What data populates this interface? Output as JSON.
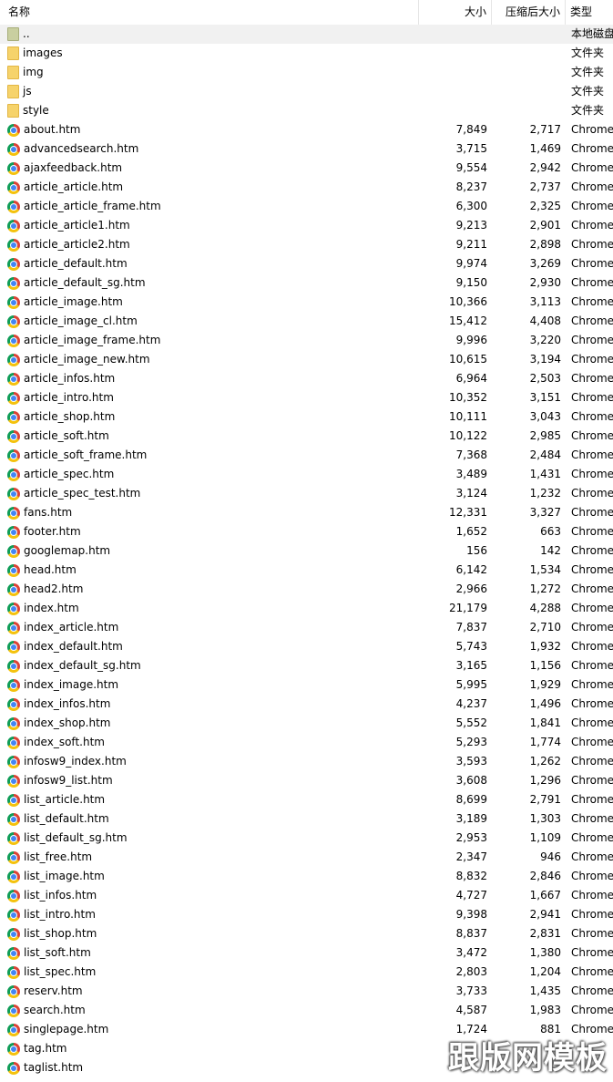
{
  "columns": {
    "name": "名称",
    "size": "大小",
    "compressed": "压缩后大小",
    "type": "类型"
  },
  "rows": [
    {
      "name": "..",
      "size": "",
      "csize": "",
      "type": "本地磁盘",
      "kind": "parent"
    },
    {
      "name": "images",
      "size": "",
      "csize": "",
      "type": "文件夹",
      "kind": "folder"
    },
    {
      "name": "img",
      "size": "",
      "csize": "",
      "type": "文件夹",
      "kind": "folder"
    },
    {
      "name": "js",
      "size": "",
      "csize": "",
      "type": "文件夹",
      "kind": "folder"
    },
    {
      "name": "style",
      "size": "",
      "csize": "",
      "type": "文件夹",
      "kind": "folder"
    },
    {
      "name": "about.htm",
      "size": "7,849",
      "csize": "2,717",
      "type": "Chrome",
      "kind": "file"
    },
    {
      "name": "advancedsearch.htm",
      "size": "3,715",
      "csize": "1,469",
      "type": "Chrome",
      "kind": "file"
    },
    {
      "name": "ajaxfeedback.htm",
      "size": "9,554",
      "csize": "2,942",
      "type": "Chrome",
      "kind": "file"
    },
    {
      "name": "article_article.htm",
      "size": "8,237",
      "csize": "2,737",
      "type": "Chrome",
      "kind": "file"
    },
    {
      "name": "article_article_frame.htm",
      "size": "6,300",
      "csize": "2,325",
      "type": "Chrome",
      "kind": "file"
    },
    {
      "name": "article_article1.htm",
      "size": "9,213",
      "csize": "2,901",
      "type": "Chrome",
      "kind": "file"
    },
    {
      "name": "article_article2.htm",
      "size": "9,211",
      "csize": "2,898",
      "type": "Chrome",
      "kind": "file"
    },
    {
      "name": "article_default.htm",
      "size": "9,974",
      "csize": "3,269",
      "type": "Chrome",
      "kind": "file"
    },
    {
      "name": "article_default_sg.htm",
      "size": "9,150",
      "csize": "2,930",
      "type": "Chrome",
      "kind": "file"
    },
    {
      "name": "article_image.htm",
      "size": "10,366",
      "csize": "3,113",
      "type": "Chrome",
      "kind": "file"
    },
    {
      "name": "article_image_cl.htm",
      "size": "15,412",
      "csize": "4,408",
      "type": "Chrome",
      "kind": "file"
    },
    {
      "name": "article_image_frame.htm",
      "size": "9,996",
      "csize": "3,220",
      "type": "Chrome",
      "kind": "file"
    },
    {
      "name": "article_image_new.htm",
      "size": "10,615",
      "csize": "3,194",
      "type": "Chrome",
      "kind": "file"
    },
    {
      "name": "article_infos.htm",
      "size": "6,964",
      "csize": "2,503",
      "type": "Chrome",
      "kind": "file"
    },
    {
      "name": "article_intro.htm",
      "size": "10,352",
      "csize": "3,151",
      "type": "Chrome",
      "kind": "file"
    },
    {
      "name": "article_shop.htm",
      "size": "10,111",
      "csize": "3,043",
      "type": "Chrome",
      "kind": "file"
    },
    {
      "name": "article_soft.htm",
      "size": "10,122",
      "csize": "2,985",
      "type": "Chrome",
      "kind": "file"
    },
    {
      "name": "article_soft_frame.htm",
      "size": "7,368",
      "csize": "2,484",
      "type": "Chrome",
      "kind": "file"
    },
    {
      "name": "article_spec.htm",
      "size": "3,489",
      "csize": "1,431",
      "type": "Chrome",
      "kind": "file"
    },
    {
      "name": "article_spec_test.htm",
      "size": "3,124",
      "csize": "1,232",
      "type": "Chrome",
      "kind": "file"
    },
    {
      "name": "fans.htm",
      "size": "12,331",
      "csize": "3,327",
      "type": "Chrome",
      "kind": "file"
    },
    {
      "name": "footer.htm",
      "size": "1,652",
      "csize": "663",
      "type": "Chrome",
      "kind": "file"
    },
    {
      "name": "googlemap.htm",
      "size": "156",
      "csize": "142",
      "type": "Chrome",
      "kind": "file"
    },
    {
      "name": "head.htm",
      "size": "6,142",
      "csize": "1,534",
      "type": "Chrome",
      "kind": "file"
    },
    {
      "name": "head2.htm",
      "size": "2,966",
      "csize": "1,272",
      "type": "Chrome",
      "kind": "file"
    },
    {
      "name": "index.htm",
      "size": "21,179",
      "csize": "4,288",
      "type": "Chrome",
      "kind": "file"
    },
    {
      "name": "index_article.htm",
      "size": "7,837",
      "csize": "2,710",
      "type": "Chrome",
      "kind": "file"
    },
    {
      "name": "index_default.htm",
      "size": "5,743",
      "csize": "1,932",
      "type": "Chrome",
      "kind": "file"
    },
    {
      "name": "index_default_sg.htm",
      "size": "3,165",
      "csize": "1,156",
      "type": "Chrome",
      "kind": "file"
    },
    {
      "name": "index_image.htm",
      "size": "5,995",
      "csize": "1,929",
      "type": "Chrome",
      "kind": "file"
    },
    {
      "name": "index_infos.htm",
      "size": "4,237",
      "csize": "1,496",
      "type": "Chrome",
      "kind": "file"
    },
    {
      "name": "index_shop.htm",
      "size": "5,552",
      "csize": "1,841",
      "type": "Chrome",
      "kind": "file"
    },
    {
      "name": "index_soft.htm",
      "size": "5,293",
      "csize": "1,774",
      "type": "Chrome",
      "kind": "file"
    },
    {
      "name": "infosw9_index.htm",
      "size": "3,593",
      "csize": "1,262",
      "type": "Chrome",
      "kind": "file"
    },
    {
      "name": "infosw9_list.htm",
      "size": "3,608",
      "csize": "1,296",
      "type": "Chrome",
      "kind": "file"
    },
    {
      "name": "list_article.htm",
      "size": "8,699",
      "csize": "2,791",
      "type": "Chrome",
      "kind": "file"
    },
    {
      "name": "list_default.htm",
      "size": "3,189",
      "csize": "1,303",
      "type": "Chrome",
      "kind": "file"
    },
    {
      "name": "list_default_sg.htm",
      "size": "2,953",
      "csize": "1,109",
      "type": "Chrome",
      "kind": "file"
    },
    {
      "name": "list_free.htm",
      "size": "2,347",
      "csize": "946",
      "type": "Chrome",
      "kind": "file"
    },
    {
      "name": "list_image.htm",
      "size": "8,832",
      "csize": "2,846",
      "type": "Chrome",
      "kind": "file"
    },
    {
      "name": "list_infos.htm",
      "size": "4,727",
      "csize": "1,667",
      "type": "Chrome",
      "kind": "file"
    },
    {
      "name": "list_intro.htm",
      "size": "9,398",
      "csize": "2,941",
      "type": "Chrome",
      "kind": "file"
    },
    {
      "name": "list_shop.htm",
      "size": "8,837",
      "csize": "2,831",
      "type": "Chrome",
      "kind": "file"
    },
    {
      "name": "list_soft.htm",
      "size": "3,472",
      "csize": "1,380",
      "type": "Chrome",
      "kind": "file"
    },
    {
      "name": "list_spec.htm",
      "size": "2,803",
      "csize": "1,204",
      "type": "Chrome",
      "kind": "file"
    },
    {
      "name": "reserv.htm",
      "size": "3,733",
      "csize": "1,435",
      "type": "Chrome",
      "kind": "file"
    },
    {
      "name": "search.htm",
      "size": "4,587",
      "csize": "1,983",
      "type": "Chrome",
      "kind": "file"
    },
    {
      "name": "singlepage.htm",
      "size": "1,724",
      "csize": "881",
      "type": "Chrome",
      "kind": "file"
    },
    {
      "name": "tag.htm",
      "size": "",
      "csize": "",
      "type": "",
      "kind": "file"
    },
    {
      "name": "taglist.htm",
      "size": "",
      "csize": "",
      "type": "",
      "kind": "file"
    }
  ],
  "icons": {
    "folder": "folder-icon",
    "parent": "parent-folder-icon",
    "file": "chrome-icon"
  },
  "watermark": "跟版网模板"
}
